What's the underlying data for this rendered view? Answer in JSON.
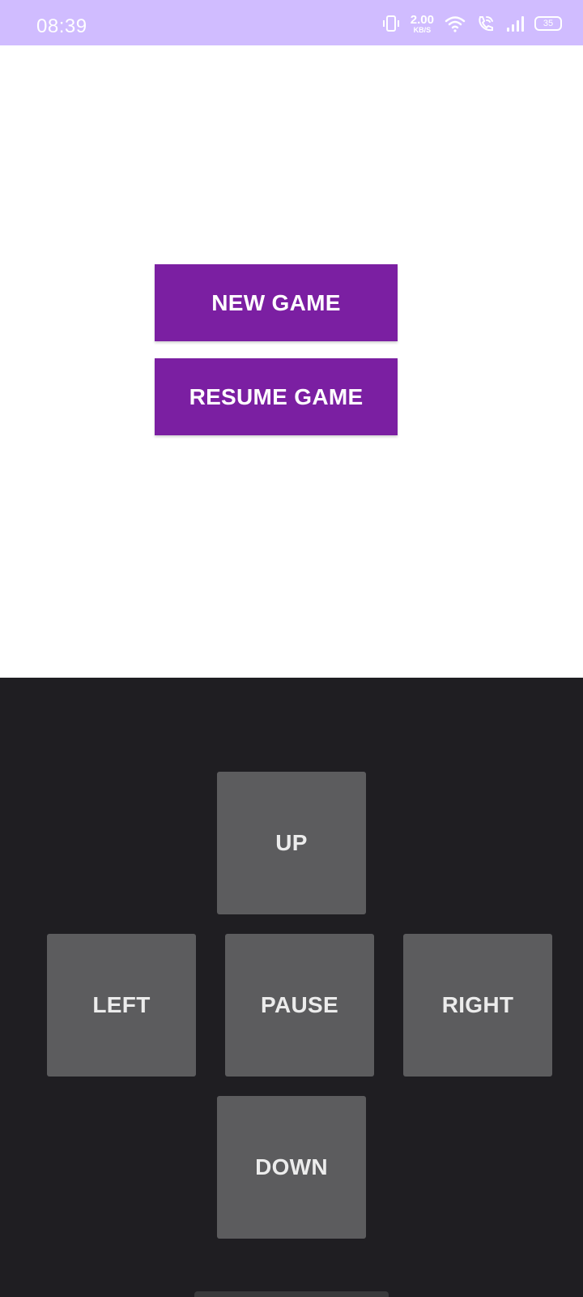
{
  "status_bar": {
    "time": "08:39",
    "net_speed_value": "2.00",
    "net_speed_unit": "KB/S",
    "battery": "35",
    "icons": [
      "vibrate-icon",
      "wifi-icon",
      "wifi-call-icon",
      "signal-icon",
      "battery-icon"
    ],
    "background": "#d0bcff"
  },
  "menu": {
    "new_game": "NEW GAME",
    "resume_game": "RESUME GAME",
    "button_color": "#7b1fa2"
  },
  "controls": {
    "up": "UP",
    "left": "LEFT",
    "pause": "PAUSE",
    "right": "RIGHT",
    "down": "DOWN",
    "background": "#1f1e22",
    "button_color": "#5c5c5e"
  }
}
